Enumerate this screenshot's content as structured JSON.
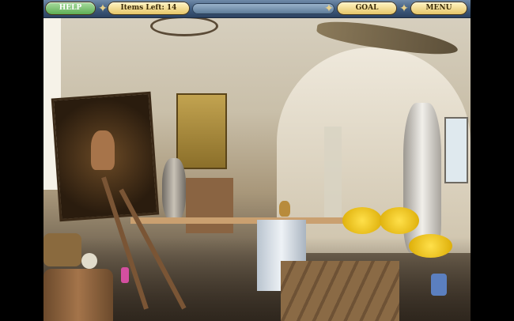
{
  "hud": {
    "help_label": "HELP",
    "items_left_label": "Items Left: 14",
    "goal_label": "GOAL",
    "menu_label": "MENU"
  },
  "colors": {
    "bar": "#3e5a7c",
    "pill_gold": "#e6c66a",
    "pill_green": "#5fae55"
  }
}
